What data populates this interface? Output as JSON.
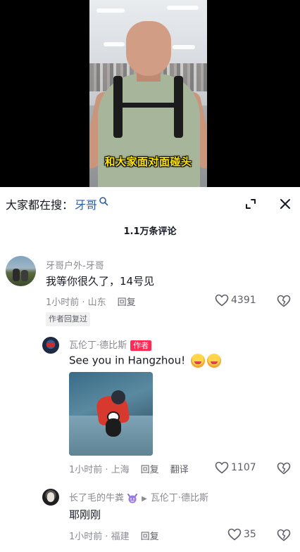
{
  "video": {
    "subtitle": "和大家面对面碰头"
  },
  "search": {
    "prefix": "大家都在搜：",
    "term": "牙哥"
  },
  "comments_count": "1.1万条评论",
  "comments": [
    {
      "username": "牙哥户外-牙哥",
      "text": "我等你很久了，14号见",
      "time_location": "1小时前 · 山东",
      "reply_label": "回复",
      "likes": "4391",
      "badge": "作者回复过"
    }
  ],
  "replies": [
    {
      "username": "瓦伦丁·德比斯",
      "author_tag": "作者",
      "text": "See you in Hangzhou!",
      "time_location": "1小时前 · 上海",
      "reply_label": "回复",
      "translate_label": "翻译",
      "likes": "1107"
    },
    {
      "username": "长了毛的牛粪",
      "reply_to": "瓦伦丁·德比斯",
      "text": "耶刚刚",
      "time_location": "1小时前 · 福建",
      "reply_label": "回复",
      "likes": "35"
    }
  ],
  "icons": {
    "search": "search-icon",
    "expand": "expand-icon",
    "close": "close-icon",
    "heart": "heart-icon",
    "dislike": "broken-heart-icon"
  },
  "colors": {
    "author_tag": "#fe2c55",
    "link": "#2d5fa0",
    "subtitle": "#ffe600"
  }
}
